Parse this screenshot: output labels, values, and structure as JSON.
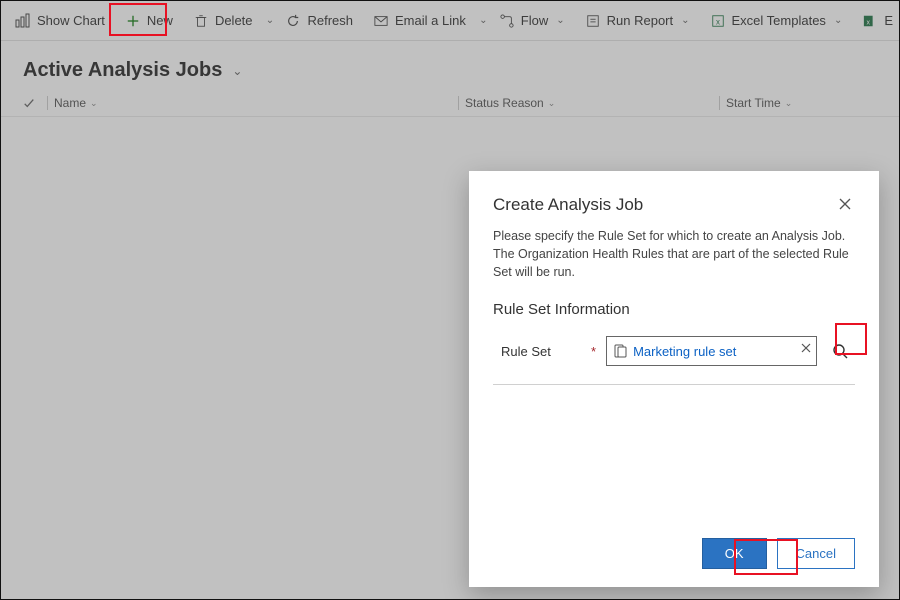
{
  "toolbar": {
    "show_chart": "Show Chart",
    "new": "New",
    "delete": "Delete",
    "refresh": "Refresh",
    "email_link": "Email a Link",
    "flow": "Flow",
    "run_report": "Run Report",
    "excel_templates": "Excel Templates",
    "excel_export_trunc": "E"
  },
  "view": {
    "title": "Active Analysis Jobs"
  },
  "grid": {
    "columns": [
      "Name",
      "Status Reason",
      "Start Time"
    ]
  },
  "dialog": {
    "title": "Create Analysis Job",
    "description": "Please specify the Rule Set for which to create an Analysis Job. The Organization Health Rules that are part of the selected Rule Set will be run.",
    "section": "Rule Set Information",
    "field_label": "Rule Set",
    "selected_rule_set": "Marketing rule set",
    "ok": "OK",
    "cancel": "Cancel"
  }
}
